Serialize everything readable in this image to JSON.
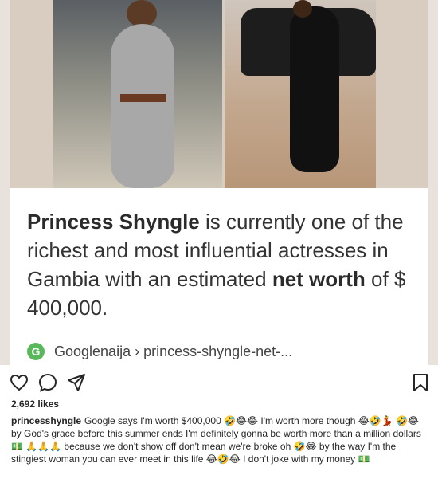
{
  "card": {
    "name_bold": "Princess Shyngle",
    "text_part1": " is currently one of the richest and most influential actresses in Gambia with an estimated ",
    "bold2": "net worth",
    "text_part2": " of $ 400,000."
  },
  "source": {
    "logo_letter": "G",
    "text": "Googlenaija › princess-shyngle-net-..."
  },
  "actions": {
    "like_icon": "heart-icon",
    "comment_icon": "comment-icon",
    "share_icon": "paper-plane-icon",
    "save_icon": "bookmark-icon"
  },
  "likes": "2,692 likes",
  "caption": {
    "username": "princesshyngle",
    "text": "Google says I'm worth $400,000 🤣😂😂 I'm worth more though 😂🤣💃 🤣😂 by God's grace before this summer ends I'm definitely gonna be worth more than a million dollars 💵 🙏🙏🙏 because we don't show off don't mean we're broke oh 🤣😂 by the way I'm the stingiest woman you can ever meet in this life 😂🤣😂 I don't joke with my money 💵"
  },
  "colors": {
    "logo_green": "#59b95a",
    "text": "#262626",
    "card_bg": "#e9e2dc"
  }
}
